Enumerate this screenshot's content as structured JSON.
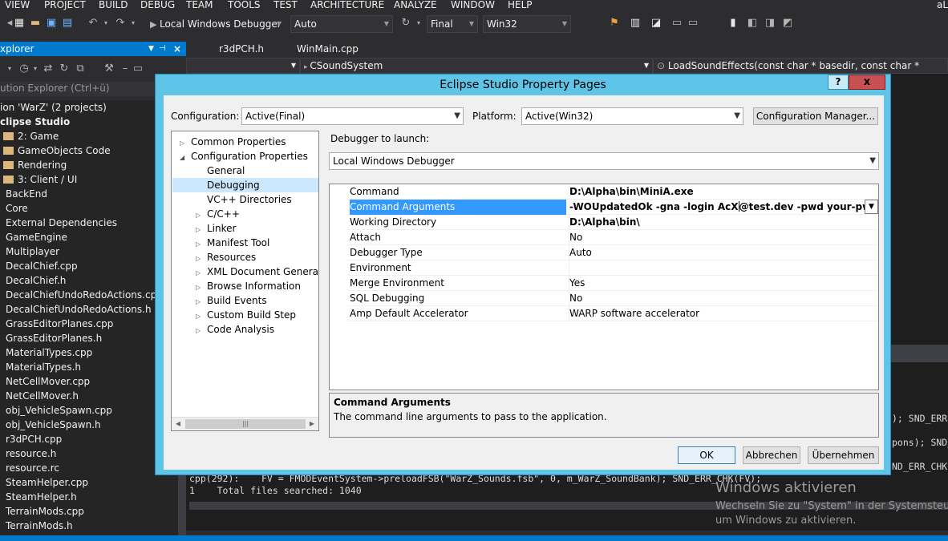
{
  "menu": [
    "VIEW",
    "PROJECT",
    "BUILD",
    "DEBUG",
    "TEAM",
    "TOOLS",
    "TEST",
    "ARCHITECTURE",
    "ANALYZE",
    "WINDOW",
    "HELP"
  ],
  "menu_right": "aL",
  "toolbar": {
    "debugger": "Local Windows Debugger",
    "mode": "Auto",
    "config": "Final",
    "platform": "Win32"
  },
  "solution_explorer": {
    "title": "xplorer",
    "search": "ution Explorer (Ctrl+ü)",
    "items": [
      {
        "label": "ion 'WarZ' (2 projects)",
        "bold": false
      },
      {
        "label": "clipse Studio",
        "bold": true
      },
      {
        "label": "2: Game",
        "folder": true
      },
      {
        "label": "GameObjects Code",
        "folder": true
      },
      {
        "label": "Rendering",
        "folder": true
      },
      {
        "label": "3: Client / UI",
        "folder": true
      },
      {
        "label": "BackEnd"
      },
      {
        "label": "Core"
      },
      {
        "label": "External Dependencies"
      },
      {
        "label": "GameEngine"
      },
      {
        "label": "Multiplayer"
      },
      {
        "label": "DecalChief.cpp"
      },
      {
        "label": "DecalChief.h"
      },
      {
        "label": "DecalChiefUndoRedoActions.cpp"
      },
      {
        "label": "DecalChiefUndoRedoActions.h"
      },
      {
        "label": "GrassEditorPlanes.cpp"
      },
      {
        "label": "GrassEditorPlanes.h"
      },
      {
        "label": "MaterialTypes.cpp"
      },
      {
        "label": "MaterialTypes.h"
      },
      {
        "label": "NetCellMover.cpp"
      },
      {
        "label": "NetCellMover.h"
      },
      {
        "label": "obj_VehicleSpawn.cpp"
      },
      {
        "label": "obj_VehicleSpawn.h"
      },
      {
        "label": "r3dPCH.cpp"
      },
      {
        "label": "resource.h"
      },
      {
        "label": "resource.rc"
      },
      {
        "label": "SteamHelper.cpp"
      },
      {
        "label": "SteamHelper.h"
      },
      {
        "label": "TerrainMods.cpp"
      },
      {
        "label": "TerrainMods.h"
      }
    ]
  },
  "editor": {
    "tabs": [
      "r3dPCH.h",
      "WinMain.cpp"
    ],
    "class_nav": "CSoundSystem",
    "member_nav": "LoadSoundEffects(const char * basedir, const char * fname)"
  },
  "output": {
    "right_fragments": [
      "); SND_ERR",
      "pons); SND_",
      "ND_ERR_CHK("
    ],
    "line1": "cpp(292):    FV = FMODEventSystem->preloadFSB(\"WarZ_Sounds.fsb\", 0, m_WarZ_SoundBank); SND_ERR_CHK(FV);",
    "line2": "1    Total files searched: 1040"
  },
  "dialog": {
    "title": "Eclipse Studio Property Pages",
    "help": "?",
    "close": "x",
    "configuration_label": "Configuration:",
    "configuration_value": "Active(Final)",
    "platform_label": "Platform:",
    "platform_value": "Active(Win32)",
    "config_manager": "Configuration Manager...",
    "tree": [
      {
        "label": "Common Properties",
        "expander": "▷",
        "indent": 0
      },
      {
        "label": "Configuration Properties",
        "expander": "◢",
        "indent": 0
      },
      {
        "label": "General",
        "expander": "",
        "indent": 1
      },
      {
        "label": "Debugging",
        "expander": "",
        "indent": 1,
        "selected": true
      },
      {
        "label": "VC++ Directories",
        "expander": "",
        "indent": 1
      },
      {
        "label": "C/C++",
        "expander": "▷",
        "indent": 1
      },
      {
        "label": "Linker",
        "expander": "▷",
        "indent": 1
      },
      {
        "label": "Manifest Tool",
        "expander": "▷",
        "indent": 1
      },
      {
        "label": "Resources",
        "expander": "▷",
        "indent": 1
      },
      {
        "label": "XML Document Generator",
        "expander": "▷",
        "indent": 1
      },
      {
        "label": "Browse Information",
        "expander": "▷",
        "indent": 1
      },
      {
        "label": "Build Events",
        "expander": "▷",
        "indent": 1
      },
      {
        "label": "Custom Build Step",
        "expander": "▷",
        "indent": 1
      },
      {
        "label": "Code Analysis",
        "expander": "▷",
        "indent": 1
      }
    ],
    "debugger_label": "Debugger to launch:",
    "debugger_value": "Local Windows Debugger",
    "properties": [
      {
        "name": "Command",
        "value": "D:\\Alpha\\bin\\MiniA.exe",
        "bold": true
      },
      {
        "name": "Command Arguments",
        "value_a": "-WOUpdatedOk -gna -login AcX",
        "value_b": "@test.dev -pwd your-pwd",
        "bold": true,
        "selected": true
      },
      {
        "name": "Working Directory",
        "value": "D:\\Alpha\\bin\\",
        "bold": true
      },
      {
        "name": "Attach",
        "value": "No"
      },
      {
        "name": "Debugger Type",
        "value": "Auto"
      },
      {
        "name": "Environment",
        "value": ""
      },
      {
        "name": "Merge Environment",
        "value": "Yes"
      },
      {
        "name": "SQL Debugging",
        "value": "No"
      },
      {
        "name": "Amp Default Accelerator",
        "value": "WARP software accelerator"
      }
    ],
    "desc_title": "Command Arguments",
    "desc_text": "The command line arguments to pass to the application.",
    "ok": "OK",
    "cancel": "Abbrechen",
    "apply": "Übernehmen"
  },
  "watermark": {
    "line1": "Windows aktivieren",
    "line2": "Wechseln Sie zu \"System\" in der Systemsteu",
    "line3": "um Windows zu aktivieren."
  }
}
